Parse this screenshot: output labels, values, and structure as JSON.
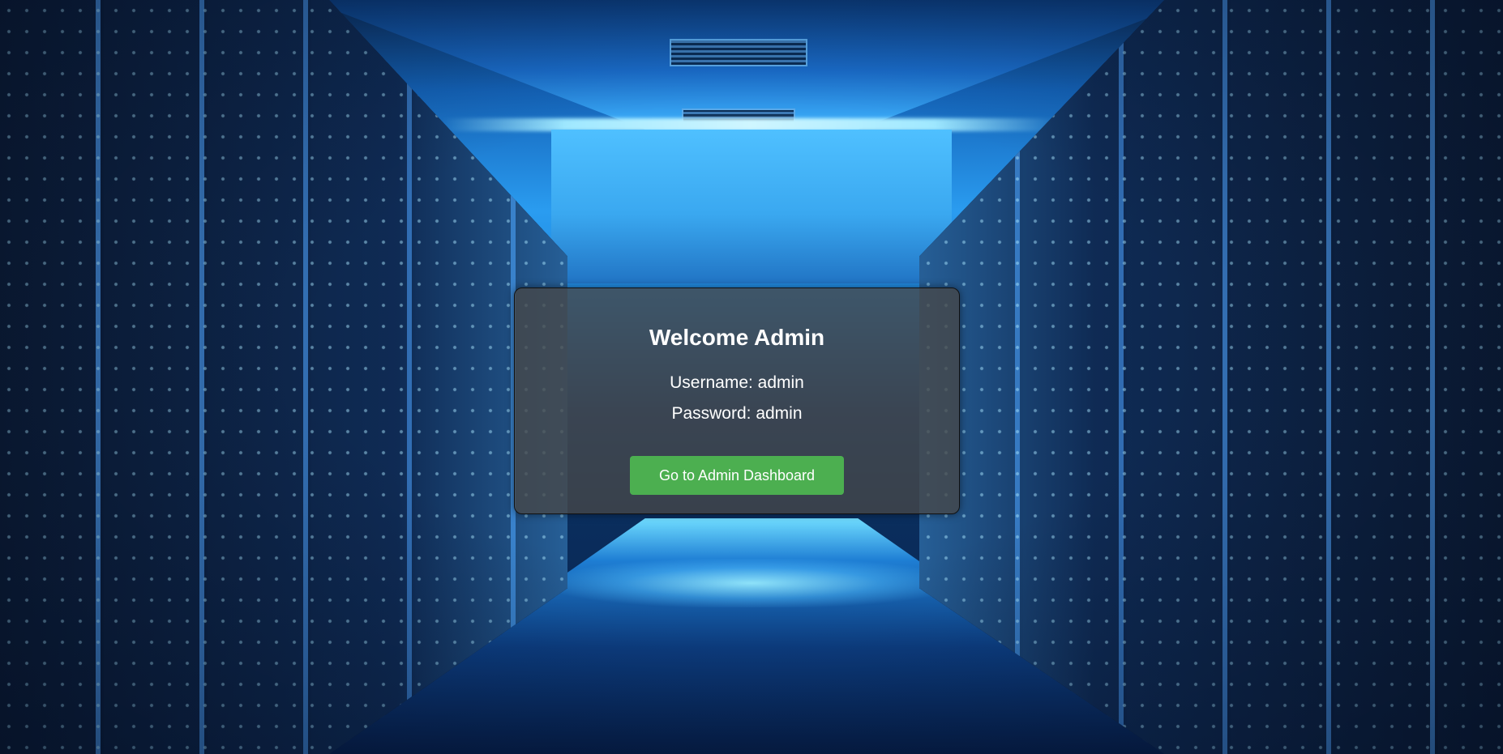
{
  "card": {
    "title": "Welcome Admin",
    "username_line": "Username: admin",
    "password_line": "Password: admin",
    "button_label": "Go to Admin Dashboard"
  },
  "colors": {
    "button_bg": "#4caf50",
    "card_bg": "rgba(70,70,70,0.78)",
    "text": "#ffffff"
  },
  "background": {
    "scene": "data-center-server-room",
    "theme_color": "#1f86dc"
  }
}
